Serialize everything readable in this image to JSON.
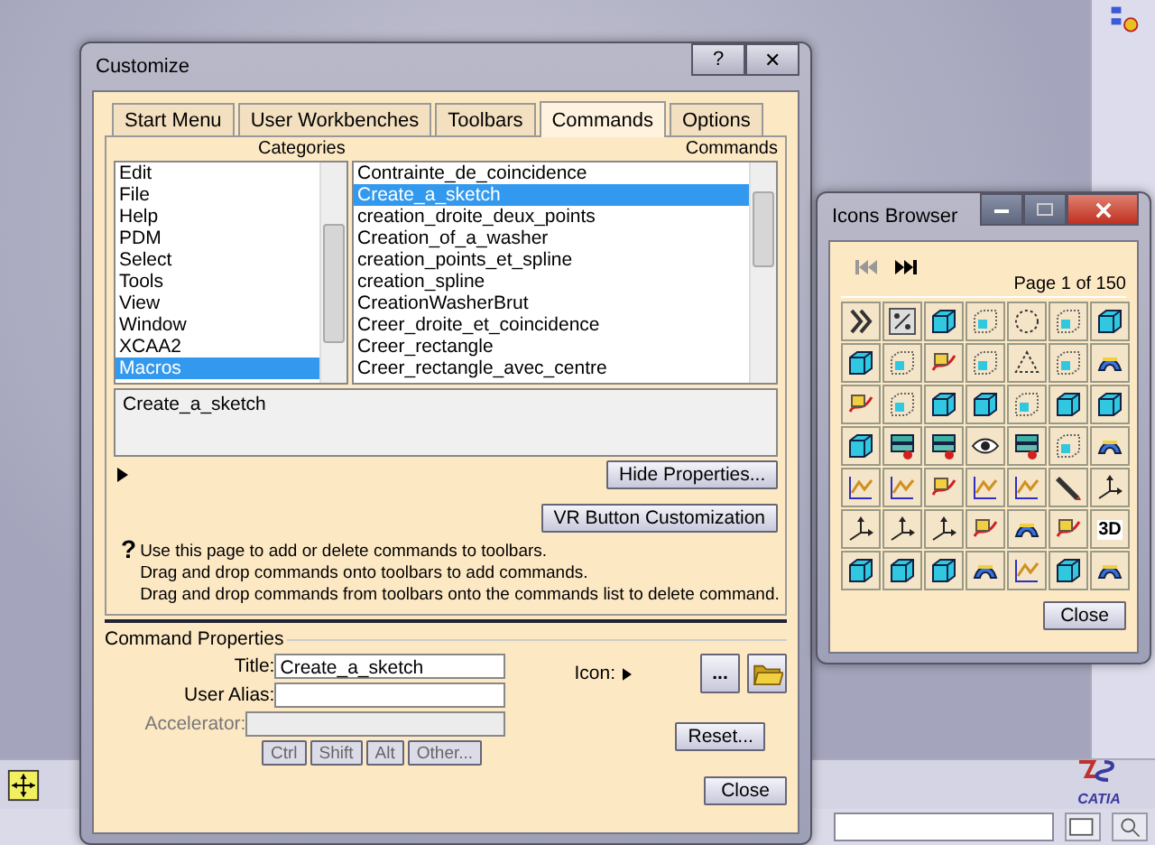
{
  "customize": {
    "title": "Customize",
    "help_button": "?",
    "close_button": "✕",
    "tabs": [
      {
        "label": "Start Menu",
        "selected": false
      },
      {
        "label": "User Workbenches",
        "selected": false
      },
      {
        "label": "Toolbars",
        "selected": false
      },
      {
        "label": "Commands",
        "selected": true
      },
      {
        "label": "Options",
        "selected": false
      }
    ],
    "categories_label": "Categories",
    "commands_label": "Commands",
    "categories": [
      {
        "label": "Edit",
        "selected": false
      },
      {
        "label": "File",
        "selected": false
      },
      {
        "label": "Help",
        "selected": false
      },
      {
        "label": "PDM",
        "selected": false
      },
      {
        "label": "Select",
        "selected": false
      },
      {
        "label": "Tools",
        "selected": false
      },
      {
        "label": "View",
        "selected": false
      },
      {
        "label": "Window",
        "selected": false
      },
      {
        "label": "XCAA2",
        "selected": false
      },
      {
        "label": "Macros",
        "selected": true
      }
    ],
    "commands": [
      {
        "label": "Contrainte_de_coincidence",
        "selected": false
      },
      {
        "label": "Create_a_sketch",
        "selected": true
      },
      {
        "label": "creation_droite_deux_points",
        "selected": false
      },
      {
        "label": "Creation_of_a_washer",
        "selected": false
      },
      {
        "label": "creation_points_et_spline",
        "selected": false
      },
      {
        "label": "creation_spline",
        "selected": false
      },
      {
        "label": "CreationWasherBrut",
        "selected": false
      },
      {
        "label": "Creer_droite_et_coincidence",
        "selected": false
      },
      {
        "label": "Creer_rectangle",
        "selected": false
      },
      {
        "label": "Creer_rectangle_avec_centre",
        "selected": false
      }
    ],
    "description": "Create_a_sketch",
    "hide_properties_button": "Hide Properties...",
    "vr_button": "VR Button Customization",
    "help_icon": "?",
    "help_lines": [
      "Use this page to add or delete commands to toolbars.",
      "Drag and drop commands onto toolbars to add commands.",
      "Drag and drop commands from toolbars onto the commands list to delete command."
    ],
    "command_properties": {
      "heading": "Command Properties",
      "title_label": "Title:",
      "title_value": "Create_a_sketch",
      "user_alias_label": "User Alias:",
      "accelerator_label": "Accelerator:",
      "accelerator_disabled": true,
      "modifier_buttons": [
        {
          "label": "Ctrl",
          "disabled": true
        },
        {
          "label": "Shift",
          "disabled": true
        },
        {
          "label": "Alt",
          "disabled": true
        },
        {
          "label": "Other...",
          "disabled": true
        }
      ],
      "icon_label": "Icon:",
      "browse_button": "...",
      "reset_button": "Reset..."
    },
    "close_button_label": "Close"
  },
  "icons_browser": {
    "title": "Icons Browser",
    "first_disabled": true,
    "last_disabled": false,
    "page": "Page 1 of 150",
    "icons": [
      {
        "kind": "chevron"
      },
      {
        "kind": "percent"
      },
      {
        "kind": "solid"
      },
      {
        "kind": "dotted"
      },
      {
        "kind": "circle"
      },
      {
        "kind": "dotted"
      },
      {
        "kind": "solid"
      },
      {
        "kind": "solid"
      },
      {
        "kind": "dotted"
      },
      {
        "kind": "sketch"
      },
      {
        "kind": "dotted"
      },
      {
        "kind": "triangle"
      },
      {
        "kind": "dotted"
      },
      {
        "kind": "surface"
      },
      {
        "kind": "sketch"
      },
      {
        "kind": "dotted"
      },
      {
        "kind": "solid"
      },
      {
        "kind": "solid"
      },
      {
        "kind": "dotted"
      },
      {
        "kind": "solid"
      },
      {
        "kind": "solid"
      },
      {
        "kind": "solid"
      },
      {
        "kind": "layers"
      },
      {
        "kind": "layers"
      },
      {
        "kind": "eye"
      },
      {
        "kind": "layers"
      },
      {
        "kind": "dotted"
      },
      {
        "kind": "surface"
      },
      {
        "kind": "graph"
      },
      {
        "kind": "graph"
      },
      {
        "kind": "sketch"
      },
      {
        "kind": "graph"
      },
      {
        "kind": "graph"
      },
      {
        "kind": "pencil"
      },
      {
        "kind": "axis"
      },
      {
        "kind": "axis"
      },
      {
        "kind": "axis"
      },
      {
        "kind": "axis"
      },
      {
        "kind": "sketch"
      },
      {
        "kind": "surface"
      },
      {
        "kind": "sketch"
      },
      {
        "kind": "text",
        "label": "3D"
      },
      {
        "kind": "solid"
      },
      {
        "kind": "solid"
      },
      {
        "kind": "solid"
      },
      {
        "kind": "surface"
      },
      {
        "kind": "graph"
      },
      {
        "kind": "solid"
      },
      {
        "kind": "surface"
      }
    ],
    "close_button": "Close"
  },
  "status_logo": "CATIA"
}
